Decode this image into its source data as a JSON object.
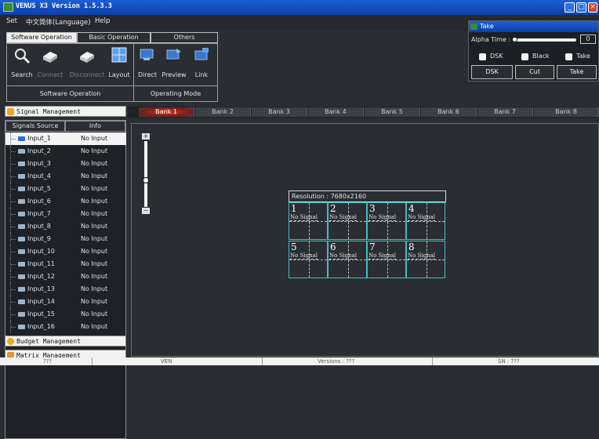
{
  "window": {
    "title": "VENUS X3 Version 1.5.3.3"
  },
  "menu": [
    "Set",
    "中文简体(Language)",
    "Help"
  ],
  "ribbon": {
    "tabs": [
      "Software Operation",
      "Basic Operation",
      "Others"
    ],
    "buttons": [
      {
        "label": "Search",
        "icon": "search-icon",
        "enabled": true
      },
      {
        "label": "Connect",
        "icon": "connect-icon",
        "enabled": false
      },
      {
        "label": "Disconnect",
        "icon": "disconnect-icon",
        "enabled": false
      },
      {
        "label": "Layout",
        "icon": "layout-icon",
        "enabled": true
      },
      {
        "label": "Direct",
        "icon": "direct-icon",
        "enabled": true
      },
      {
        "label": "Preview",
        "icon": "preview-icon",
        "enabled": true
      },
      {
        "label": "Link",
        "icon": "link-icon",
        "enabled": true
      }
    ],
    "section_software": "Software Operation",
    "section_mode": "Operating Mode"
  },
  "banks": [
    "Bank 1",
    "Bank 2",
    "Bank 3",
    "Bank 4",
    "Bank 5",
    "Bank 6",
    "Bank 7",
    "Bank 8"
  ],
  "left": {
    "signal_header": "Signal Management",
    "col_source": "Signals Source",
    "col_info": "Info",
    "sources": [
      {
        "name": "Input_1",
        "info": "No Input"
      },
      {
        "name": "Input_2",
        "info": "No Input"
      },
      {
        "name": "Input_3",
        "info": "No Input"
      },
      {
        "name": "Input_4",
        "info": "No Input"
      },
      {
        "name": "Input_5",
        "info": "No Input"
      },
      {
        "name": "Input_6",
        "info": "No Input"
      },
      {
        "name": "Input_7",
        "info": "No Input"
      },
      {
        "name": "Input_8",
        "info": "No Input"
      },
      {
        "name": "Input_9",
        "info": "No Input"
      },
      {
        "name": "Input_10",
        "info": "No Input"
      },
      {
        "name": "Input_11",
        "info": "No Input"
      },
      {
        "name": "Input_12",
        "info": "No Input"
      },
      {
        "name": "Input_13",
        "info": "No Input"
      },
      {
        "name": "Input_14",
        "info": "No Input"
      },
      {
        "name": "Input_15",
        "info": "No Input"
      },
      {
        "name": "Input_16",
        "info": "No Input"
      }
    ],
    "budget_header": "Budget Management",
    "matrix_header": "Matrix Management"
  },
  "layout": {
    "resolution": "Resolution : 7680x2160",
    "cells": [
      {
        "num": "1",
        "sig": "No Signal"
      },
      {
        "num": "2",
        "sig": "No Signal"
      },
      {
        "num": "3",
        "sig": "No Signal"
      },
      {
        "num": "4",
        "sig": "No Signal"
      },
      {
        "num": "5",
        "sig": "No Signal"
      },
      {
        "num": "6",
        "sig": "No Signal"
      },
      {
        "num": "7",
        "sig": "No Signal"
      },
      {
        "num": "8",
        "sig": "No Signal"
      }
    ]
  },
  "slider": {
    "plus": "+",
    "minus": "−",
    "level": 0.6
  },
  "take": {
    "title": "Take",
    "alpha_label": "Alpha Time :",
    "alpha_value": "0",
    "checks": [
      "DSK",
      "Black",
      "Take"
    ],
    "buttons": [
      "DSK",
      "Cut",
      "Take"
    ]
  },
  "status": {
    "a": "???",
    "b": "VEN",
    "c": "Versions : ???",
    "d": "SN : ???"
  },
  "colors": {
    "accent": "#1c5fd6",
    "active_bank": "#d23a2c",
    "cell_border": "#3cc0c0",
    "workspace_border": "#5e7a55"
  }
}
